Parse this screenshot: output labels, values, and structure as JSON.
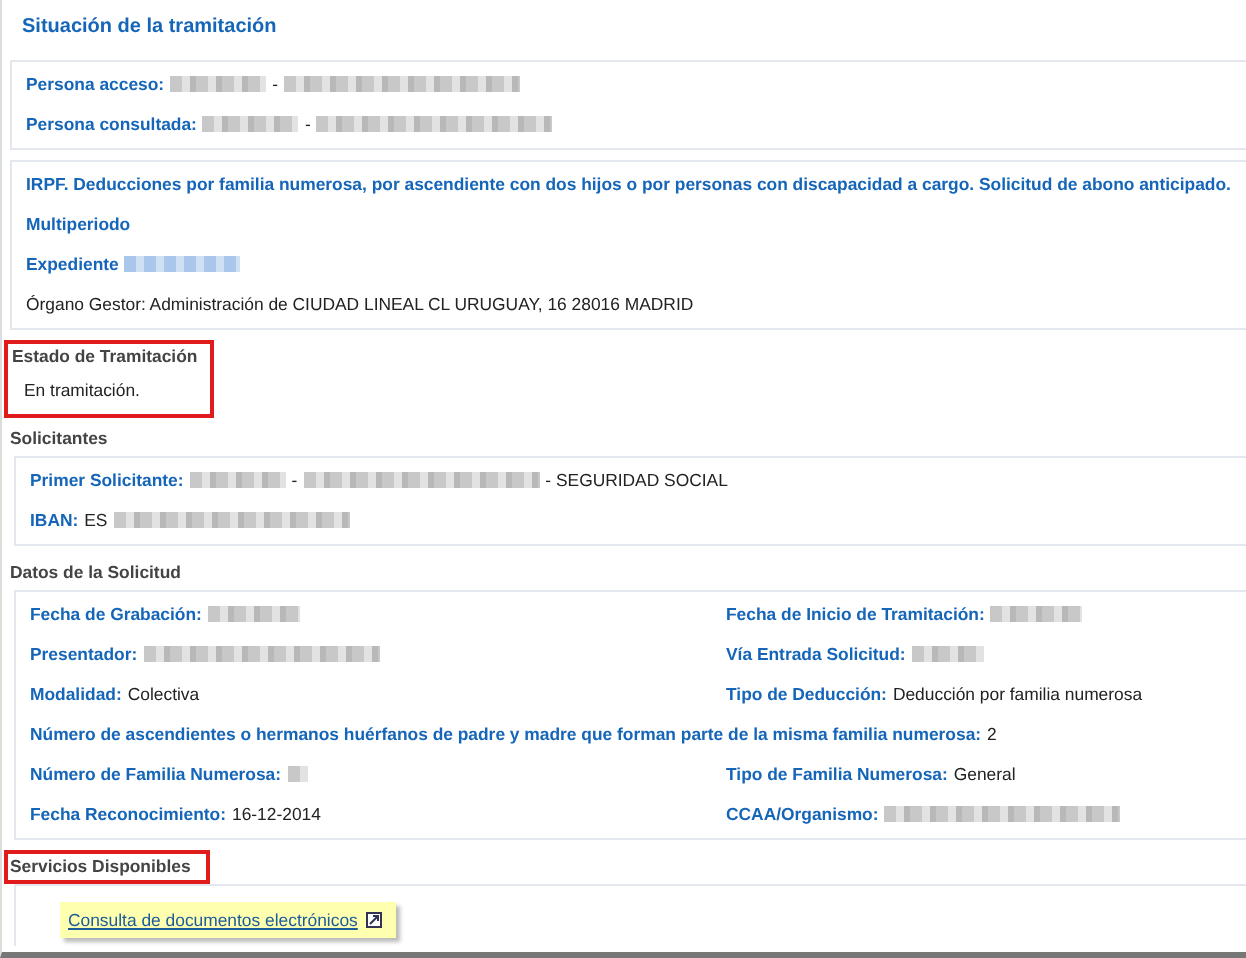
{
  "title": "Situación de la tramitación",
  "persons": [
    {
      "label": "Persona acceso:",
      "parts": [
        {
          "kind": "blur-m"
        },
        {
          "kind": "text",
          "text": "-"
        },
        {
          "kind": "blur-l"
        }
      ]
    },
    {
      "label": "Persona consultada:",
      "parts": [
        {
          "kind": "blur-m"
        },
        {
          "kind": "text",
          "text": "-"
        },
        {
          "kind": "blur-l"
        }
      ]
    }
  ],
  "procedure": {
    "heading": "IRPF. Deducciones por familia numerosa, por ascendiente con dos hijos o por personas con discapacidad a cargo. Solicitud de abono anticipado.",
    "period": "Multiperiodo",
    "file_label": "Expediente",
    "manager": "Órgano Gestor: Administración de CIUDAD LINEAL CL URUGUAY, 16 28016 MADRID"
  },
  "status": {
    "heading": "Estado de Tramitación",
    "highlighted": true,
    "text": "En tramitación."
  },
  "applicants": {
    "heading": "Solicitantes",
    "highlighted": false,
    "rows": [
      {
        "label": "Primer Solicitante:",
        "parts": [
          {
            "kind": "blur-m"
          },
          {
            "kind": "text",
            "text": "-"
          },
          {
            "kind": "blur-l"
          },
          {
            "kind": "text",
            "text": "- SEGURIDAD SOCIAL"
          }
        ]
      },
      {
        "label": "IBAN:",
        "parts": [
          {
            "kind": "text",
            "text": "ES"
          },
          {
            "kind": "blur-l"
          }
        ]
      }
    ]
  },
  "request": {
    "heading": "Datos de la Solicitud",
    "highlighted": false,
    "fields": [
      {
        "kind": "half",
        "label": "Fecha de Grabación:",
        "parts": [
          {
            "kind": "blur-s"
          }
        ]
      },
      {
        "kind": "half",
        "label": "Fecha de Inicio de Tramitación:",
        "parts": [
          {
            "kind": "blur-s"
          }
        ]
      },
      {
        "kind": "half",
        "label": "Presentador:",
        "parts": [
          {
            "kind": "blur-l"
          }
        ]
      },
      {
        "kind": "half",
        "label": "Vía Entrada Solicitud:",
        "parts": [
          {
            "kind": "blur-xs"
          }
        ]
      },
      {
        "kind": "half",
        "label": "Modalidad:",
        "parts": [
          {
            "kind": "text",
            "text": "Colectiva"
          }
        ]
      },
      {
        "kind": "half",
        "label": "Tipo de Deducción:",
        "parts": [
          {
            "kind": "text",
            "text": "Deducción por familia numerosa"
          }
        ]
      },
      {
        "kind": "full",
        "label": "Número de ascendientes o hermanos huérfanos de padre y madre que forman parte de la misma familia numerosa:",
        "parts": [
          {
            "kind": "text",
            "text": "2"
          }
        ]
      },
      {
        "kind": "half",
        "label": "Número de Familia Numerosa:",
        "parts": [
          {
            "kind": "blur-xxs"
          }
        ]
      },
      {
        "kind": "half",
        "label": "Tipo de Familia Numerosa:",
        "parts": [
          {
            "kind": "text",
            "text": "General"
          }
        ]
      },
      {
        "kind": "half",
        "label": "Fecha Reconocimiento:",
        "parts": [
          {
            "kind": "text",
            "text": "16-12-2014"
          }
        ]
      },
      {
        "kind": "half",
        "label": "CCAA/Organismo:",
        "parts": [
          {
            "kind": "blur-l"
          }
        ]
      }
    ]
  },
  "services": {
    "heading": "Servicios Disponibles",
    "highlighted": true,
    "links": [
      "Consulta de documentos electrónicos"
    ]
  }
}
